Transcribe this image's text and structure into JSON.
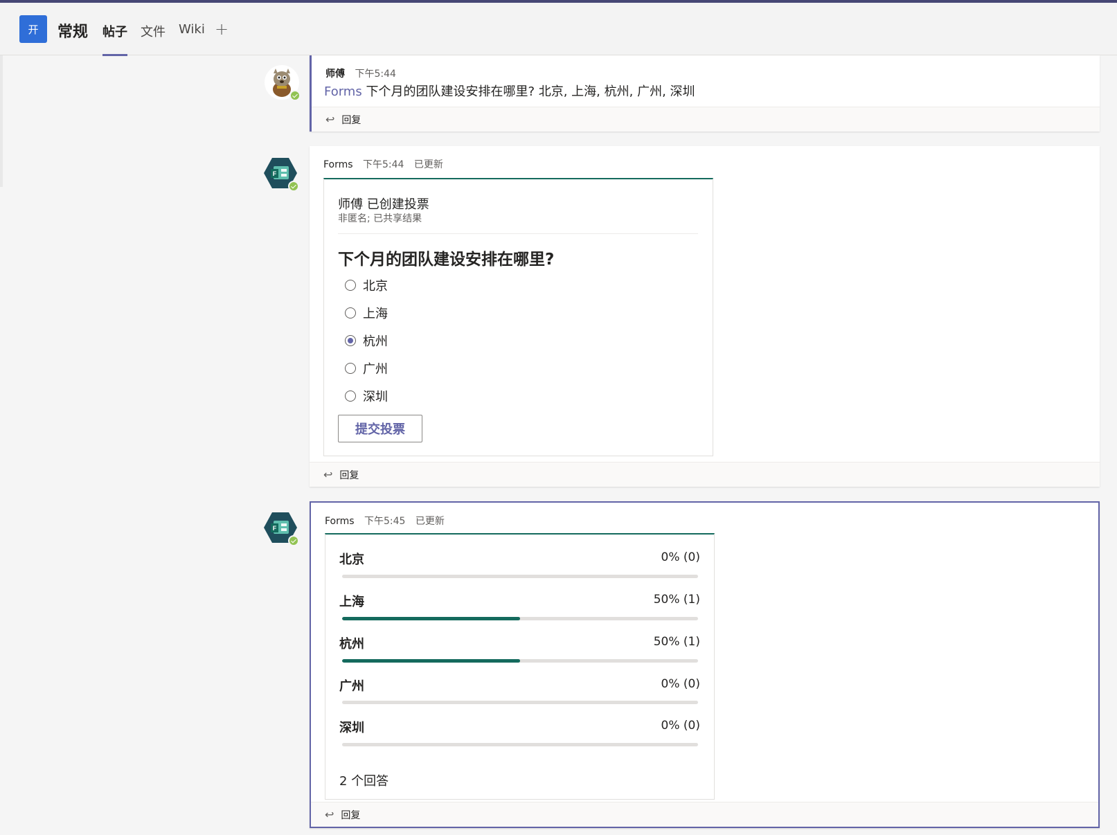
{
  "header": {
    "team_badge": "开",
    "channel_name": "常规",
    "tabs": [
      {
        "label": "帖子",
        "active": true
      },
      {
        "label": "文件",
        "active": false
      },
      {
        "label": "Wiki",
        "active": false
      }
    ],
    "add_tab": "+"
  },
  "reply_label": "回复",
  "messages": [
    {
      "sender": "师傅",
      "time": "下午5:44",
      "app_tag": "Forms",
      "text": "下个月的团队建设安排在哪里? 北京, 上海, 杭州, 广州, 深圳"
    },
    {
      "sender": "Forms",
      "time": "下午5:44",
      "edited": "已更新",
      "poll": {
        "creator_line": "师傅 已创建投票",
        "settings_line": "非匿名; 已共享结果",
        "question": "下个月的团队建设安排在哪里?",
        "options": [
          {
            "label": "北京",
            "checked": false
          },
          {
            "label": "上海",
            "checked": false
          },
          {
            "label": "杭州",
            "checked": true
          },
          {
            "label": "广州",
            "checked": false
          },
          {
            "label": "深圳",
            "checked": false
          }
        ],
        "submit_label": "提交投票"
      }
    },
    {
      "sender": "Forms",
      "time": "下午5:45",
      "edited": "已更新",
      "results": [
        {
          "label": "北京",
          "value": "0% (0)",
          "fraction": 0
        },
        {
          "label": "上海",
          "value": "50% (1)",
          "fraction": 0.5
        },
        {
          "label": "杭州",
          "value": "50% (1)",
          "fraction": 0.5
        },
        {
          "label": "广州",
          "value": "0% (0)",
          "fraction": 0
        },
        {
          "label": "深圳",
          "value": "0% (0)",
          "fraction": 0
        }
      ],
      "responses": "2 个回答"
    }
  ],
  "colors": {
    "accent": "#6264a7",
    "forms_green": "#146a5d",
    "presence": "#92c353",
    "team_badge": "#2f6ed8"
  }
}
